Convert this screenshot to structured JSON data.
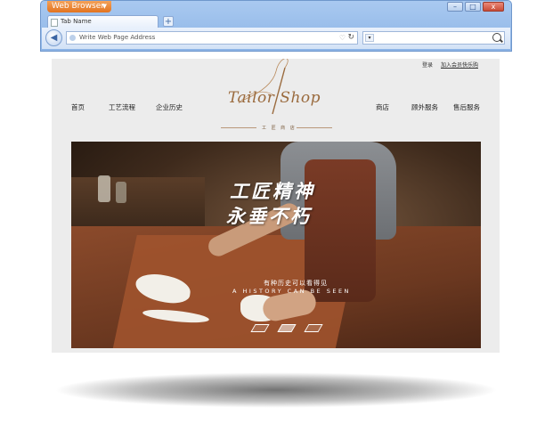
{
  "browser": {
    "app_menu_label": "Web Browser",
    "tab_title": "Tab Name",
    "new_tab_symbol": "+",
    "address_placeholder": "Write Web Page Address",
    "window_buttons": {
      "minimize": "–",
      "maximize": "□",
      "close": "x"
    }
  },
  "page": {
    "top_links": {
      "login": "登录",
      "register": "加入会员快乐购"
    },
    "nav_left": [
      "首页",
      "工艺流程",
      "企业历史"
    ],
    "nav_right": [
      "商店",
      "顾外服务",
      "售后服务"
    ],
    "logo": {
      "text": "Tailor Shop",
      "subtitle": "工 匠 商 店"
    },
    "hero": {
      "title_line1": "工匠精神",
      "title_line2": "永垂不朽",
      "subtitle_cn": "有种历史可以看得见",
      "subtitle_en": "A HISTORY CAN BE SEEN",
      "slides": 3,
      "active_slide": 2
    }
  },
  "colors": {
    "brand_gold": "#9a6a3d",
    "chrome_blue": "#8cb4e6",
    "accent_orange": "#e2731f"
  }
}
